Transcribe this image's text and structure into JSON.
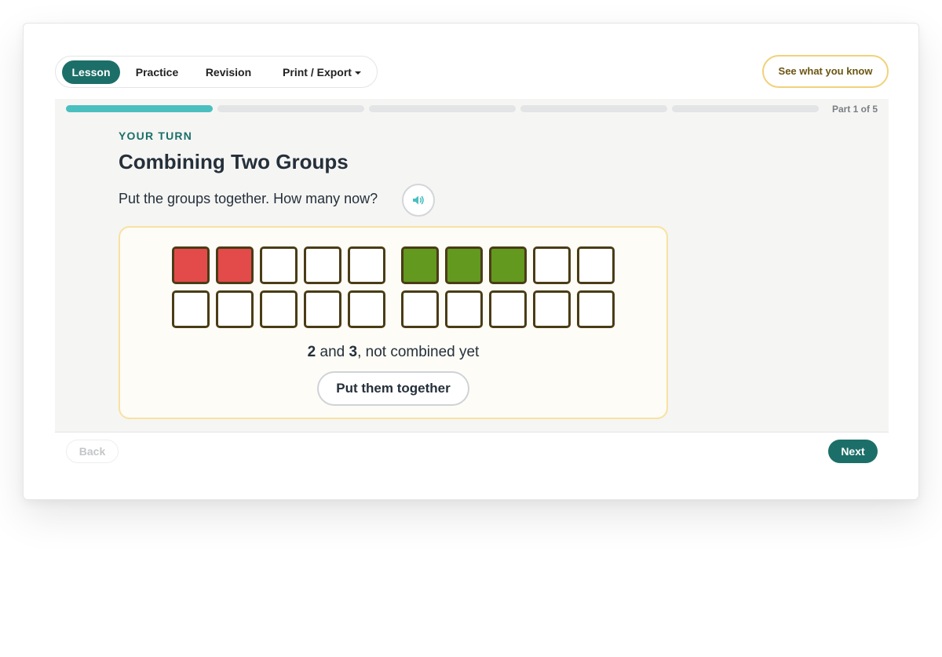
{
  "nav": {
    "tabs": [
      {
        "label": "Lesson",
        "active": true
      },
      {
        "label": "Practice",
        "active": false
      },
      {
        "label": "Revision",
        "active": false
      }
    ],
    "export_label": "Print / Export",
    "know_button": "See what you know"
  },
  "progress": {
    "label": "Part 1 of 5",
    "current": 1,
    "total": 5
  },
  "lesson": {
    "eyebrow": "YOUR TURN",
    "title": "Combining Two Groups",
    "prompt": "Put the groups together. How many now?",
    "audio_icon": "speaker-icon"
  },
  "board": {
    "group_a_count": 2,
    "group_b_count": 3,
    "group_a_color": "#e34b4b",
    "group_b_color": "#63991f",
    "status_a": "2",
    "status_and": " and ",
    "status_b": "3",
    "status_rest": ", not combined yet",
    "button": "Put them together"
  },
  "footer": {
    "back": "Back",
    "next": "Next"
  },
  "colors": {
    "accent": "#1c6f68",
    "progress": "#4abfc0",
    "highlight_border": "#f1d27a"
  }
}
